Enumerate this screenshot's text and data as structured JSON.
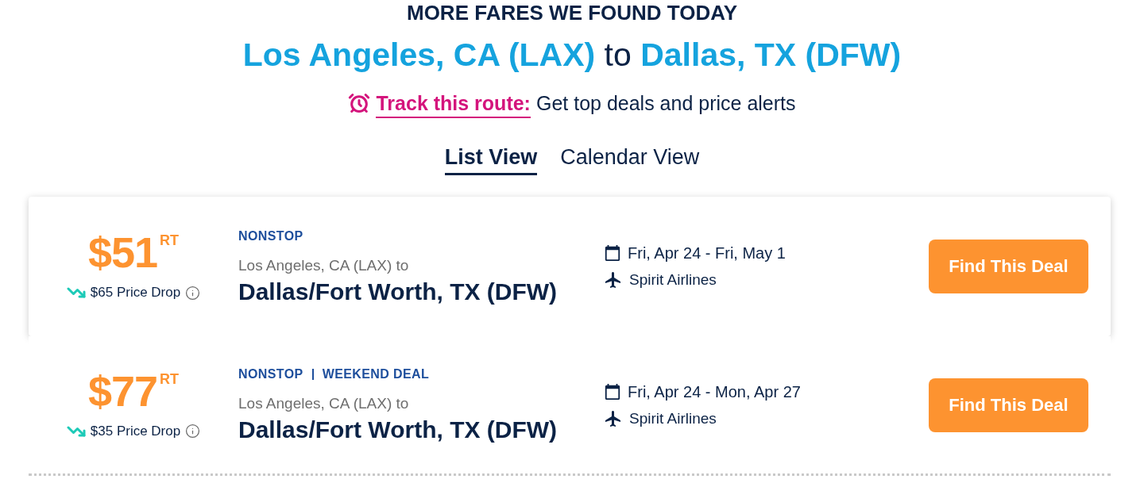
{
  "heading": "MORE FARES WE FOUND TODAY",
  "route": {
    "origin": "Los Angeles, CA (LAX)",
    "connector": "to",
    "destination": "Dallas, TX (DFW)"
  },
  "track": {
    "link": "Track this route:",
    "text": "Get top deals and price alerts"
  },
  "tabs": [
    {
      "label": "List View",
      "selected": true
    },
    {
      "label": "Calendar View",
      "selected": false
    }
  ],
  "deals": [
    {
      "highlighted": true,
      "price": "$51",
      "trip_type": "RT",
      "price_drop": "$65 Price Drop",
      "tags": [
        "NONSTOP"
      ],
      "origin": "Los Angeles, CA (LAX) to",
      "destination": "Dallas/Fort Worth, TX (DFW)",
      "dates": "Fri, Apr 24 - Fri, May 1",
      "airline": "Spirit Airlines",
      "button": "Find This Deal"
    },
    {
      "highlighted": false,
      "price": "$77",
      "trip_type": "RT",
      "price_drop": "$35 Price Drop",
      "tags": [
        "NONSTOP",
        "WEEKEND DEAL"
      ],
      "origin": "Los Angeles, CA (LAX) to",
      "destination": "Dallas/Fort Worth, TX (DFW)",
      "dates": "Fri, Apr 24 - Mon, Apr 27",
      "airline": "Spirit Airlines",
      "button": "Find This Deal"
    }
  ]
}
